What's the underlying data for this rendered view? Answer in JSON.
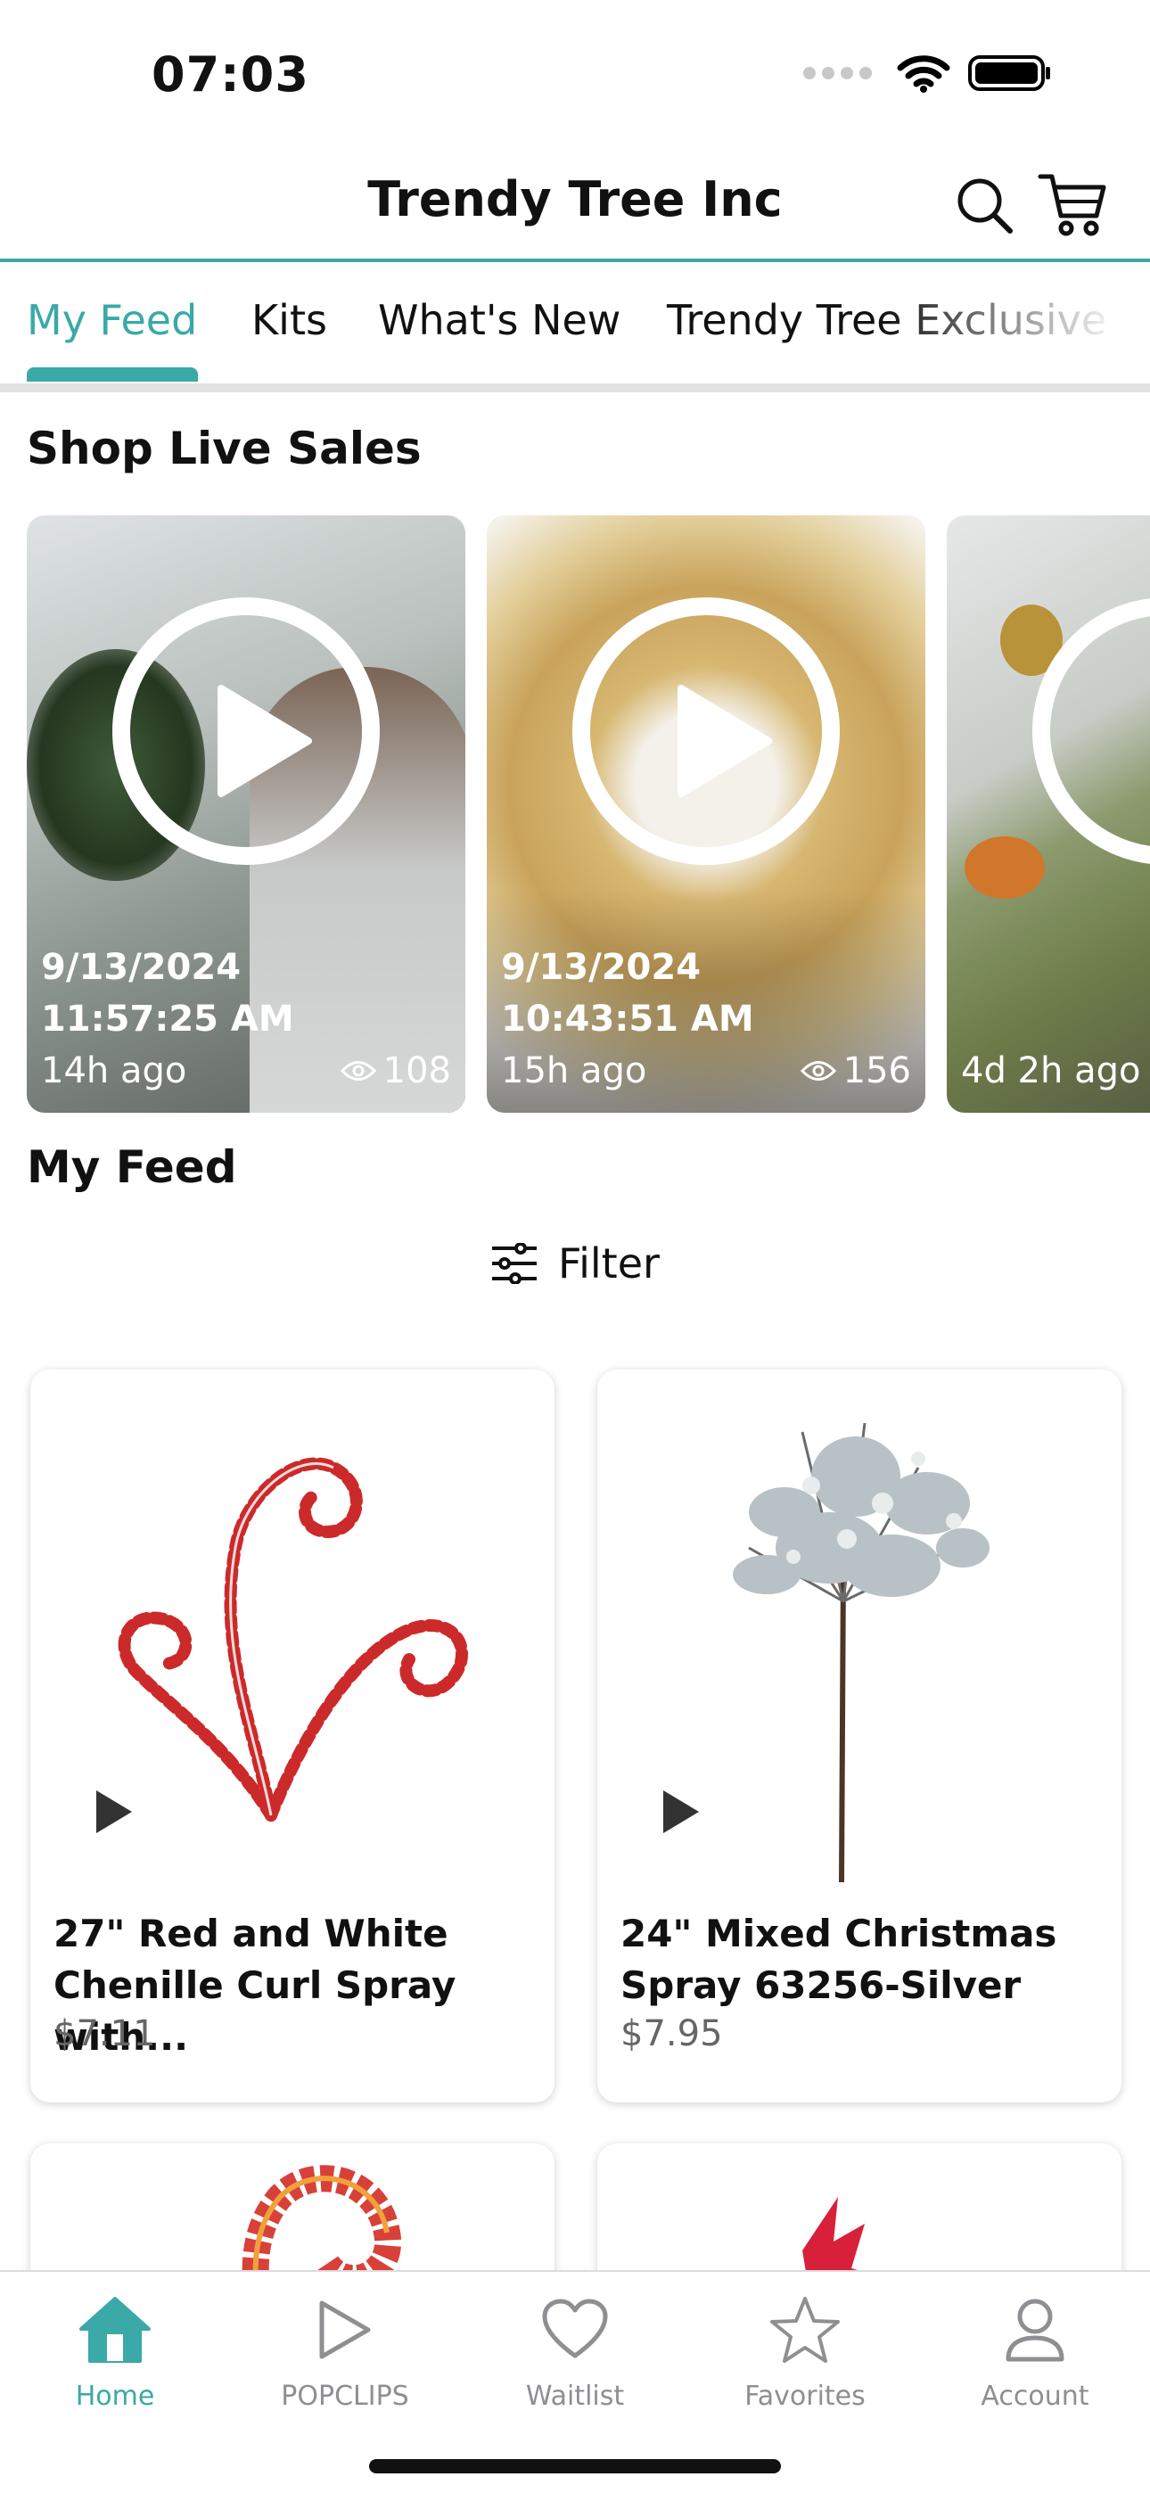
{
  "status_bar": {
    "time": "07:03"
  },
  "header": {
    "title": "Trendy Tree Inc",
    "search_icon": "search-icon",
    "cart_icon": "cart-icon"
  },
  "tabs": [
    {
      "label": "My Feed",
      "active": true
    },
    {
      "label": "Kits",
      "active": false
    },
    {
      "label": "What's New",
      "active": false
    },
    {
      "label": "Trendy Tree Exclusive S",
      "active": false
    }
  ],
  "live_section": {
    "title": "Shop Live Sales",
    "cards": [
      {
        "date": "9/13/2024",
        "time": "11:57:25 AM",
        "ago": "14h ago",
        "views": "108"
      },
      {
        "date": "9/13/2024",
        "time": "10:43:51 AM",
        "ago": "15h ago",
        "views": "156"
      },
      {
        "date": "",
        "time": "",
        "ago": "4d 2h ago",
        "views": ""
      }
    ]
  },
  "feed": {
    "title": "My Feed",
    "filter_label": "Filter",
    "products": [
      {
        "name": "27\" Red and White Chenille Curl Spray with...",
        "price": "$7.11"
      },
      {
        "name": "24\" Mixed Christmas Spray 63256-Silver",
        "price": "$7.95"
      }
    ]
  },
  "bottom_nav": [
    {
      "label": "Home",
      "icon": "home-icon",
      "active": true
    },
    {
      "label": "POPCLIPS",
      "icon": "play-icon",
      "active": false
    },
    {
      "label": "Waitlist",
      "icon": "heart-icon",
      "active": false
    },
    {
      "label": "Favorites",
      "icon": "star-icon",
      "active": false
    },
    {
      "label": "Account",
      "icon": "person-icon",
      "active": false
    }
  ],
  "colors": {
    "accent": "#3aa9a8",
    "inactive": "#8e8e93"
  }
}
